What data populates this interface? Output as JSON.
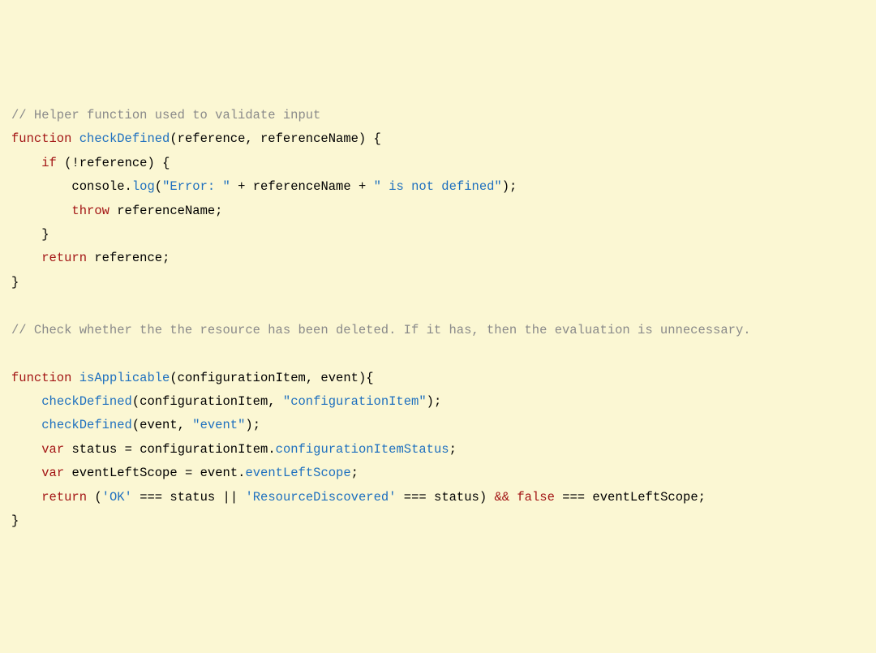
{
  "code": {
    "c1": "// Helper function used to validate input",
    "kw_function1": "function",
    "fn_checkDefined": "checkDefined",
    "p_reference": "reference",
    "p_referenceName": "referenceName",
    "kw_if": "if",
    "id_console": "console",
    "m_log": "log",
    "s_errPrefix": "\"Error: \"",
    "s_notDefined": "\" is not defined\"",
    "kw_throw": "throw",
    "kw_return1": "return",
    "c2": "// Check whether the the resource has been deleted. If it has, then the evaluation is unnecessary.",
    "kw_function2": "function",
    "fn_isApplicable": "isApplicable",
    "p_configItem": "configurationItem",
    "p_event": "event",
    "call_checkDefined1": "checkDefined",
    "s_configItem": "\"configurationItem\"",
    "call_checkDefined2": "checkDefined",
    "s_event": "\"event\"",
    "kw_var1": "var",
    "id_status": "status",
    "prop_cis": "configurationItemStatus",
    "kw_var2": "var",
    "id_els": "eventLeftScope",
    "prop_els": "eventLeftScope",
    "kw_return2": "return",
    "s_ok": "'OK'",
    "op_eq1": "===",
    "op_or": "||",
    "s_rd": "'ResourceDiscovered'",
    "op_eq2": "===",
    "op_and": "&&",
    "kw_false": "false",
    "op_eq3": "==="
  }
}
